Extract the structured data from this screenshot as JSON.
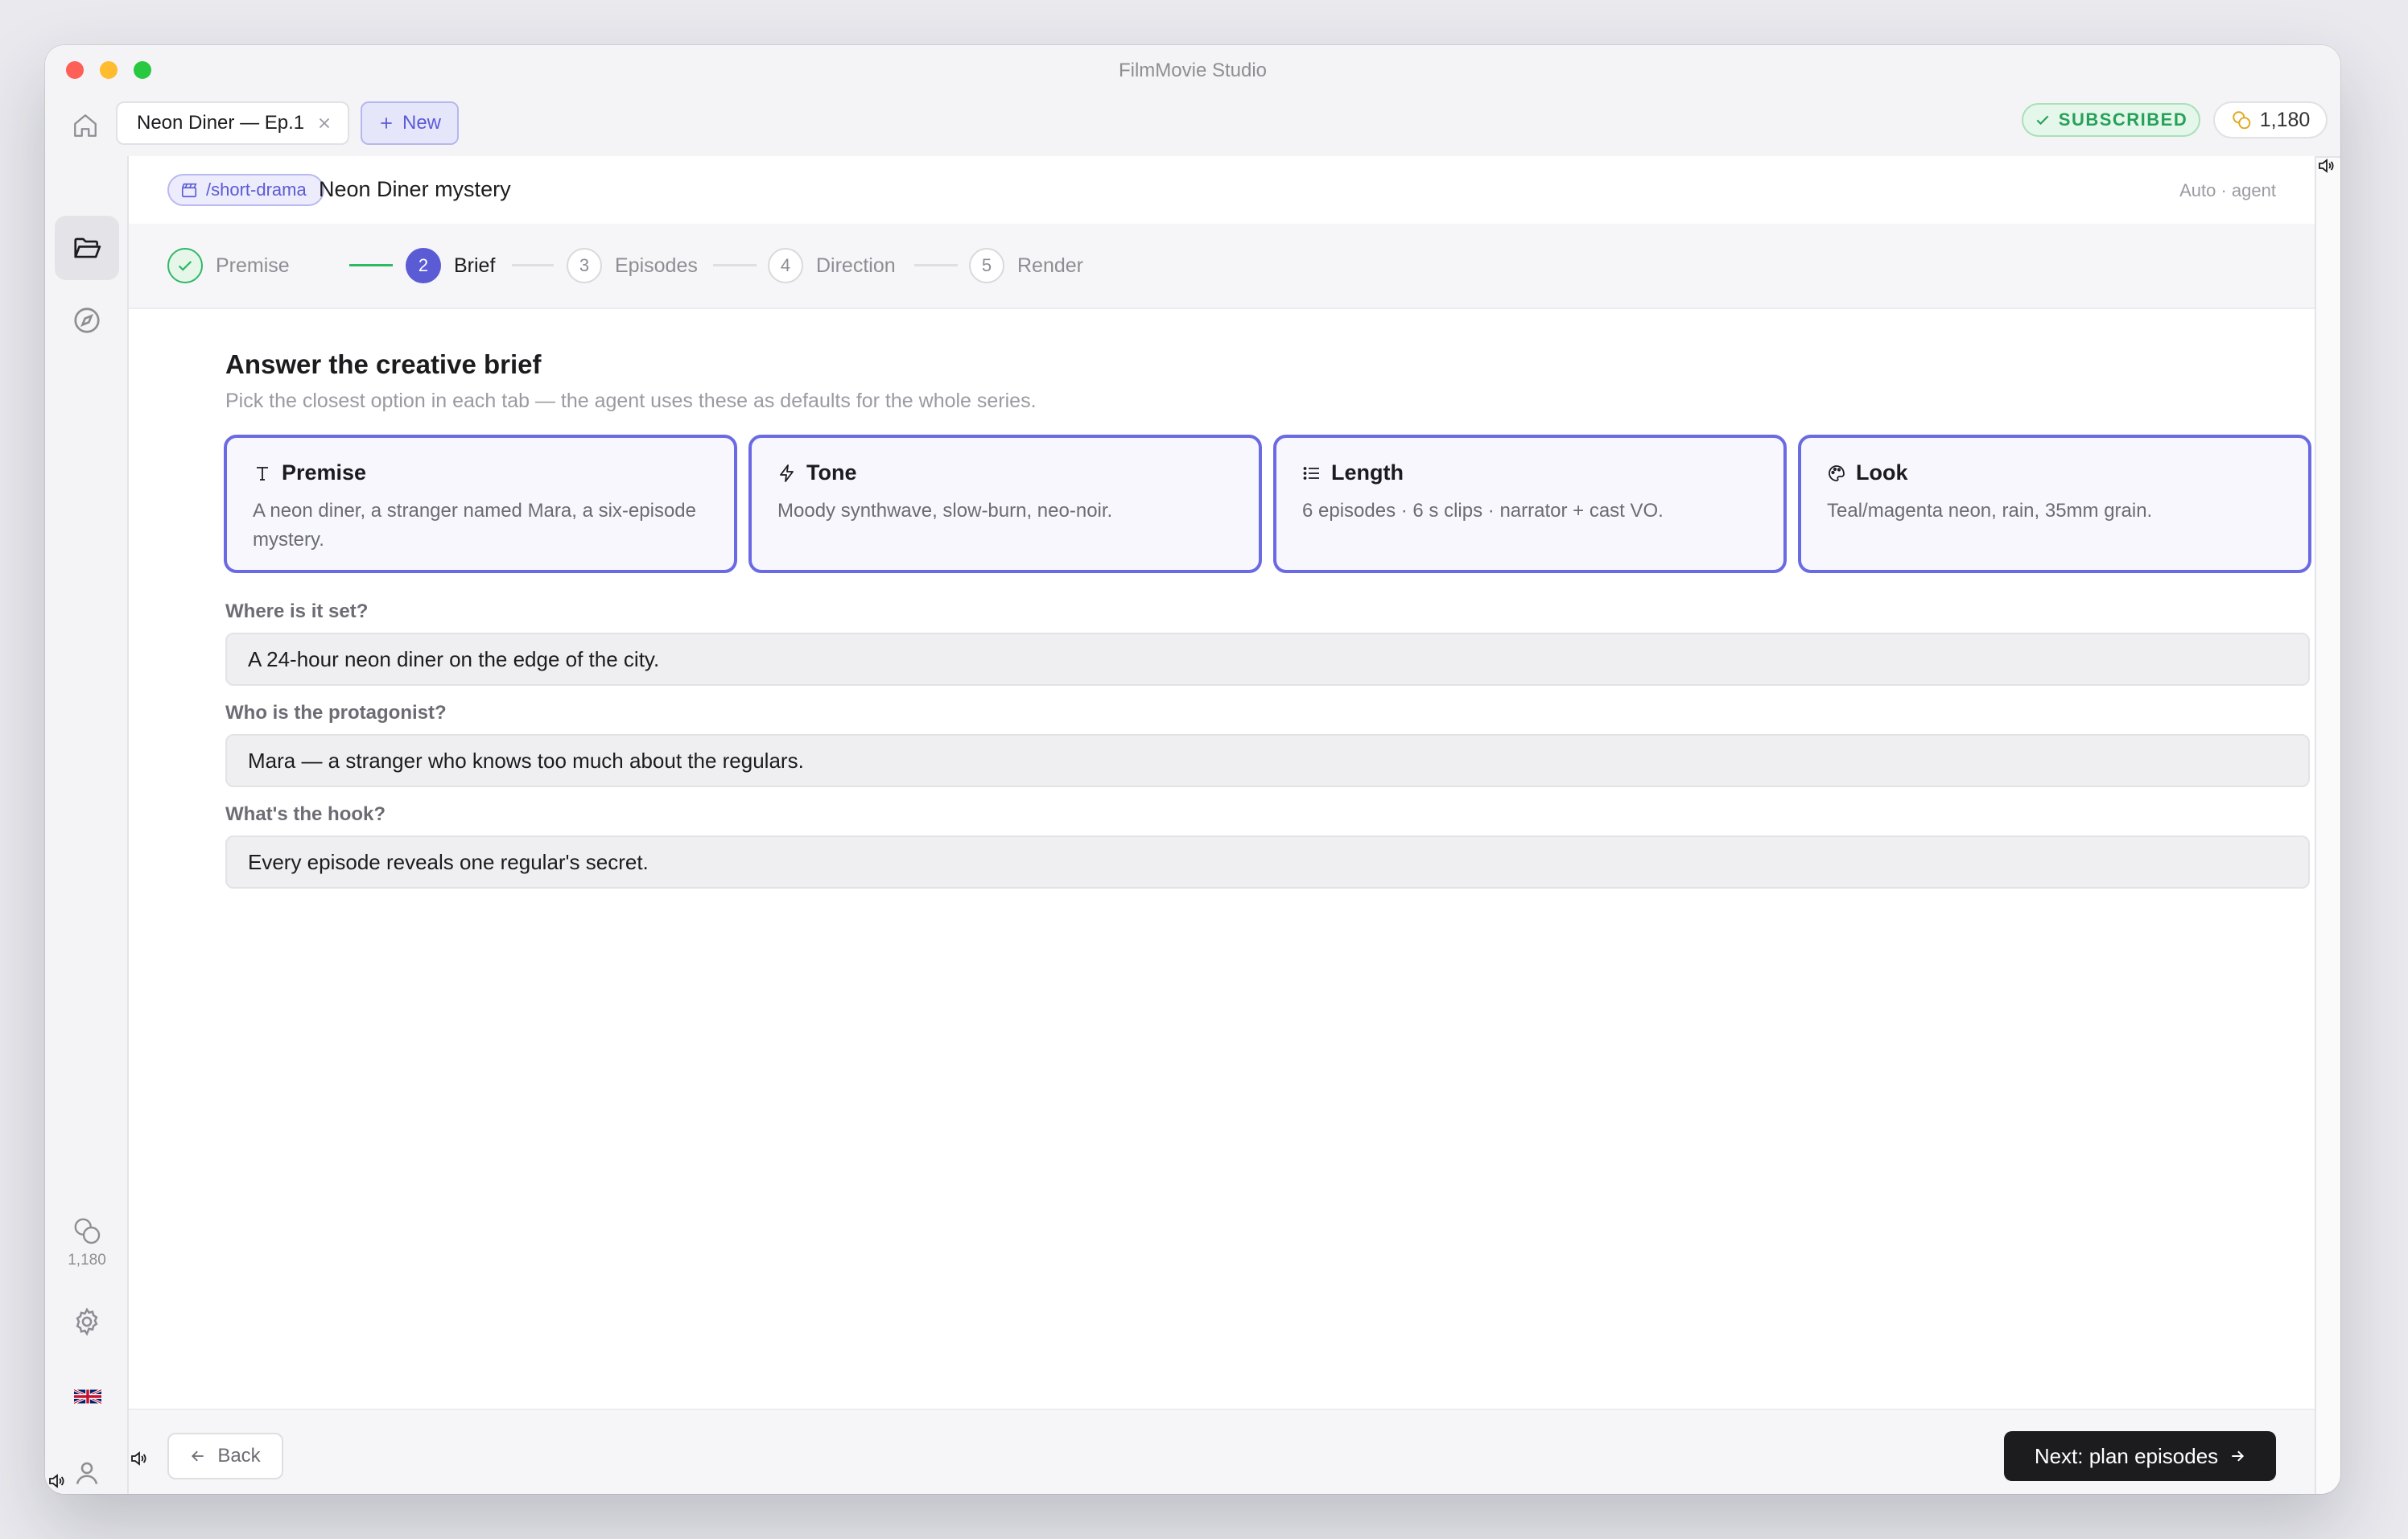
{
  "app": {
    "title": "FilmMovie Studio"
  },
  "tabs": {
    "active_label": "Neon Diner — Ep.1",
    "new_label": "New"
  },
  "account": {
    "status": "SUBSCRIBED",
    "credits": "1,180"
  },
  "sidebar": {
    "credits": "1,180"
  },
  "header": {
    "command": "/short-drama",
    "project_title": "Neon Diner mystery",
    "mode": "Auto · agent"
  },
  "stepper": {
    "steps": [
      {
        "number": "1",
        "label": "Premise",
        "state": "done"
      },
      {
        "number": "2",
        "label": "Brief",
        "state": "current"
      },
      {
        "number": "3",
        "label": "Episodes",
        "state": "pending"
      },
      {
        "number": "4",
        "label": "Direction",
        "state": "pending"
      },
      {
        "number": "5",
        "label": "Render",
        "state": "pending"
      }
    ]
  },
  "brief": {
    "title": "Answer the creative brief",
    "subtitle": "Pick the closest option in each tab — the agent uses these as defaults for the whole series.",
    "cards": [
      {
        "icon": "text-icon",
        "title": "Premise",
        "body": "A neon diner, a stranger named Mara, a six-episode mystery."
      },
      {
        "icon": "bolt-icon",
        "title": "Tone",
        "body": "Moody synthwave, slow-burn, neo-noir."
      },
      {
        "icon": "list-icon",
        "title": "Length",
        "body": "6 episodes · 6 s clips · narrator + cast VO."
      },
      {
        "icon": "palette-icon",
        "title": "Look",
        "body": "Teal/magenta neon, rain, 35mm grain."
      }
    ],
    "questions": [
      {
        "label": "Where is it set?",
        "value": "A 24-hour neon diner on the edge of the city."
      },
      {
        "label": "Who is the protagonist?",
        "value": "Mara — a stranger who knows too much about the regulars."
      },
      {
        "label": "What's the hook?",
        "value": "Every episode reveals one regular's secret."
      }
    ]
  },
  "footer": {
    "back_label": "Back",
    "next_label": "Next: plan episodes"
  },
  "colors": {
    "accent": "#5b5bd6",
    "success": "#2fb866",
    "primary_button": "#1c1c1f"
  }
}
